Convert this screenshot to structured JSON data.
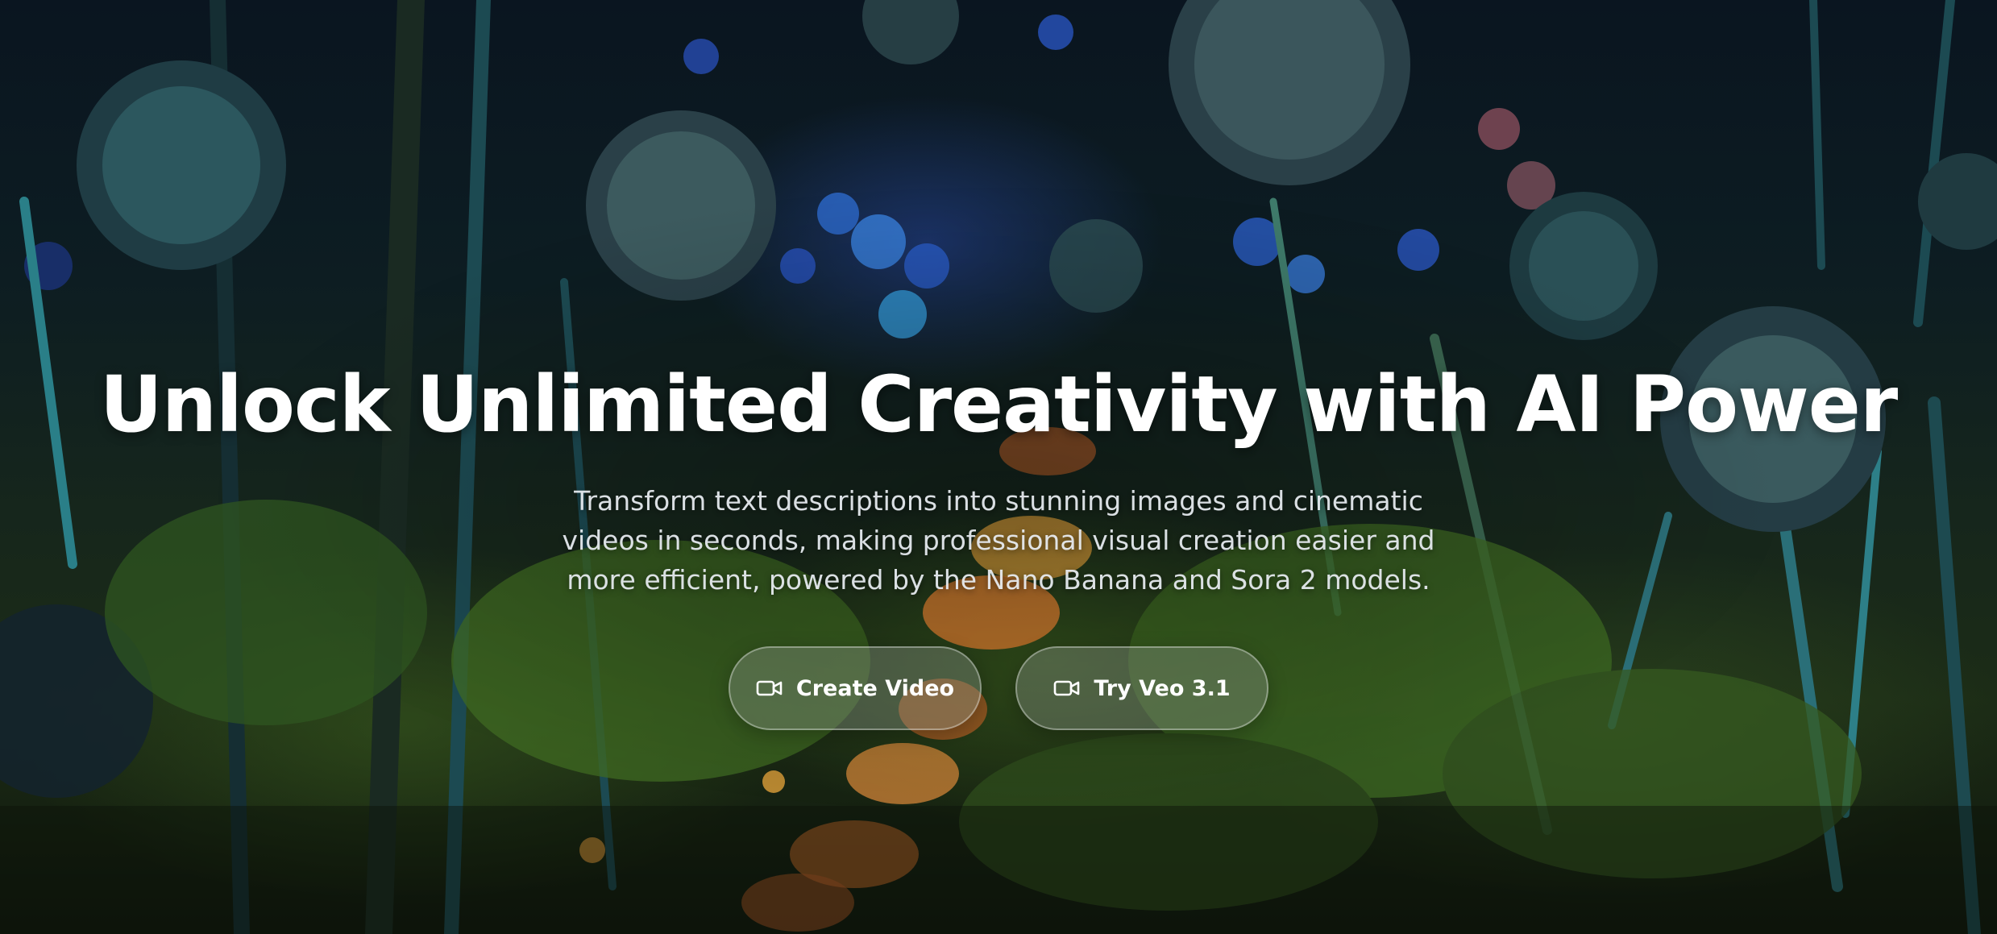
{
  "hero": {
    "title": "Unlock Unlimited Creativity with AI Power",
    "subtitle": "Transform text descriptions into stunning images and cinematic videos in seconds, making professional visual creation easier and more efficient, powered by the Nano Banana and Sora 2 models."
  },
  "actions": {
    "create_video": {
      "label": "Create Video",
      "icon": "video-camera-icon"
    },
    "try_veo": {
      "label": "Try Veo 3.1",
      "icon": "video-camera-icon"
    }
  },
  "colors": {
    "text": "#ffffff",
    "button_fill": "#8c968c",
    "button_border": "#ffffff"
  }
}
